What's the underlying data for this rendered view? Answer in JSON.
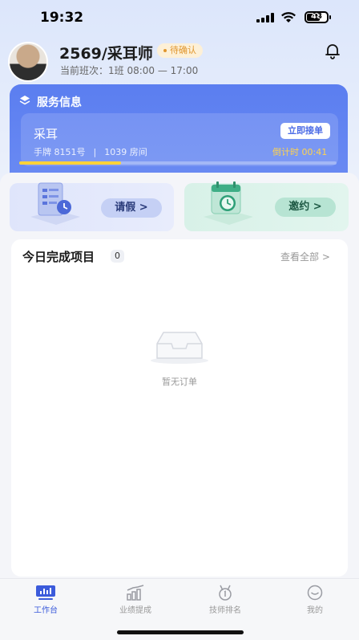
{
  "status_bar": {
    "time": "19:32",
    "battery": "48"
  },
  "header": {
    "user_name": "2569/采耳师",
    "status_badge": "待确认",
    "shift": "当前班次：1班 08:00 — 17:00"
  },
  "service": {
    "title": "服务信息",
    "name": "采耳",
    "badge_no": "手牌 8151号",
    "room": "1039 房间",
    "accept_label": "立即接单",
    "countdown": "倒计时 00:41",
    "progress_fraction": 0.32
  },
  "actions": {
    "leave_label": "请假 >",
    "invite_label": "邀约 >"
  },
  "today": {
    "title": "今日完成项目",
    "count": "0",
    "view_all": "查看全部 >",
    "empty_text": "暂无订单"
  },
  "nav": {
    "items": [
      {
        "label": "工作台"
      },
      {
        "label": "业绩提成"
      },
      {
        "label": "技师排名"
      },
      {
        "label": "我的"
      }
    ]
  },
  "colors": {
    "accent": "#3b5bdb",
    "card_blue": "#5b7ef0",
    "badge_orange": "#e0962e",
    "countdown_yellow": "#ffd34f"
  }
}
